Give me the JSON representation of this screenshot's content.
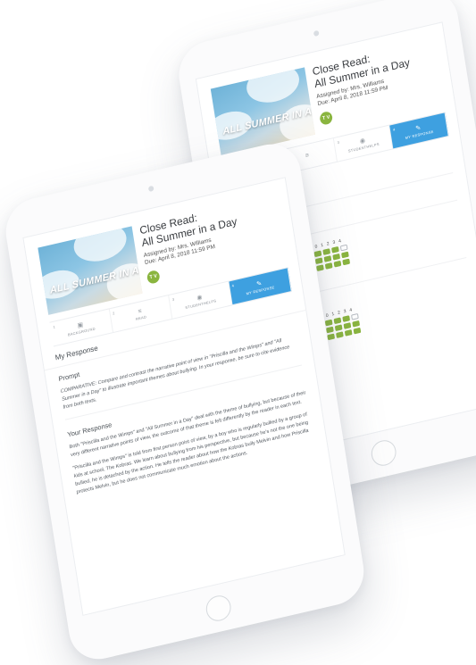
{
  "assignment": {
    "title_line1": "Close Read:",
    "title_line2": "All Summer in a Day",
    "assigned_by": "Assigned by: Mrs. Williams",
    "due": "Due: April 8, 2018 11:59 PM",
    "book_cover_text": "ALL SUMMER IN A DAY",
    "avatar_initials": "T V"
  },
  "tabs": [
    {
      "num": "1",
      "label": "BACKGROUND",
      "icon": "book-icon"
    },
    {
      "num": "2",
      "label": "READ",
      "icon": "document-icon"
    },
    {
      "num": "3",
      "label": "STUDENTHELPS",
      "icon": "globe-icon"
    },
    {
      "num": "4",
      "label": "MY RESPONSE",
      "icon": "pencil-icon"
    }
  ],
  "response": {
    "heading": "My Response",
    "prompt_label": "Prompt",
    "prompt_text": "COMPARATIVE: Compare and contrast the narrative point of view in \"Priscilla and the Wimps\" and \"All Summer in a Day\" to illustrate important themes about bullying. In your response, be sure to cite evidence from both texts.",
    "your_response_label": "Your Response",
    "paragraph1": "Both \"Priscilla and the Wimps\" and \"All Summer in a Day\" deal with the theme of bullying, but because of their very different narrative points of view, the outcome of that theme is felt differently by the reader in each text.",
    "paragraph2": "\"Priscilla and the Wimps\" is told from first person point of view, by a boy who is regularly bullied by a group of kids at school, The Kobras. We learn about bullying from his perspective, but because he's not the one being bullied, he is detached by the action. He tells the reader about how the Kobras bully Melvin and how Priscilla protects Melvin, but he does not communicate much emotion about the actions."
  },
  "rubric": {
    "scale": [
      "0",
      "1",
      "2",
      "3",
      "4"
    ],
    "peer_review_label": "eview"
  },
  "colors": {
    "accent_blue": "#3ea0e0",
    "avatar_green": "#8ab53f",
    "rubric_green": "#8ab53f"
  }
}
